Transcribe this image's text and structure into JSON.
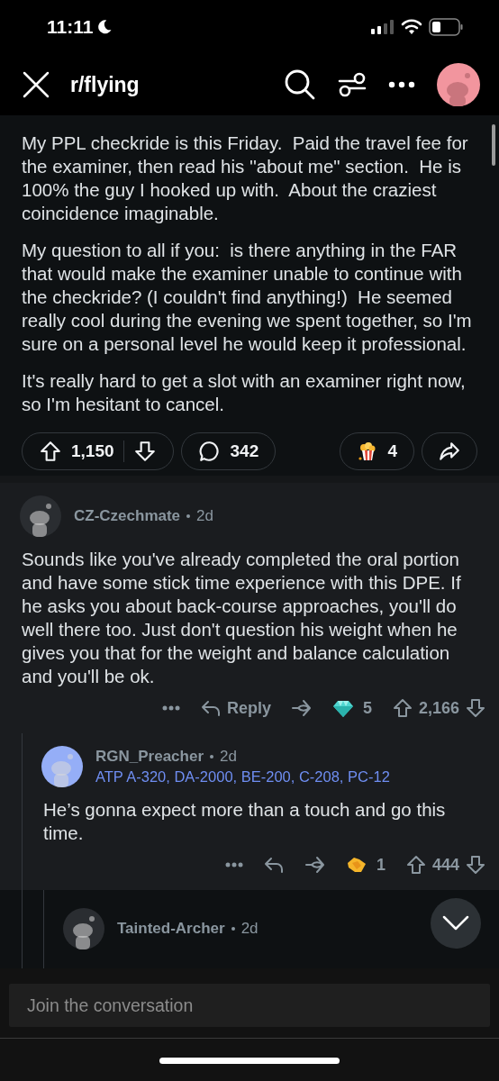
{
  "status_bar": {
    "time": "11:11"
  },
  "header": {
    "title": "r/flying"
  },
  "post": {
    "paragraphs": [
      "My PPL checkride is this Friday.  Paid the travel fee for the examiner, then read his ''about me\" section.  He is 100% the guy I hooked up with.  About the craziest coincidence imaginable.",
      "My question to all if you:  is there anything in the FAR that would make the examiner unable to continue with the checkride? (I couldn't find anything!)  He seemed really cool during the evening we spent together, so I'm sure on a personal level he would keep it professional.",
      "It's really hard to get a slot with an examiner right now, so I'm hesitant to cancel."
    ],
    "score": "1,150",
    "comments": "342",
    "award": {
      "kind": "popcorn",
      "count": "4"
    }
  },
  "comments": [
    {
      "author": "CZ-Czechmate",
      "age": "2d",
      "color": "#2a2d31",
      "body": "Sounds like you've already completed the oral portion and have some stick time experience with this DPE. If he asks you about back-course approaches, you'll do well there too. Just don't question his weight when he gives you that for the weight and balance calculation and you'll be ok.",
      "reply_label": "Reply",
      "award": {
        "kind": "diamond",
        "count": "5"
      },
      "score": "2,166",
      "children": [
        {
          "author": "RGN_Preacher",
          "age": "2d",
          "color": "#95aef7",
          "flair": "ATP A-320, DA-2000, BE-200, C-208, PC-12",
          "body": "He’s gonna expect more than a touch and go this time.",
          "award": {
            "kind": "handshake",
            "count": "1"
          },
          "score": "444",
          "children": [
            {
              "author": "Tainted-Archer",
              "age": "2d",
              "color": "#2a2d31"
            }
          ]
        }
      ]
    }
  ],
  "composer": {
    "placeholder": "Join the conversation"
  }
}
